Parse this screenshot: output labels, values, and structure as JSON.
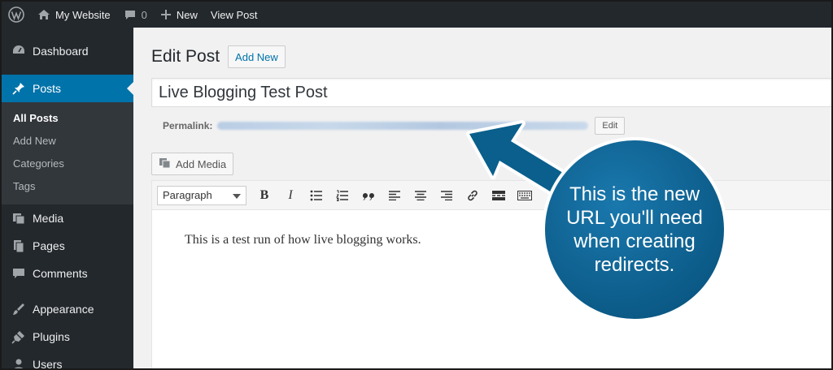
{
  "admin_bar": {
    "site_name": "My Website",
    "comments_count": "0",
    "new_label": "New",
    "view_post_label": "View Post"
  },
  "sidebar": {
    "items": [
      {
        "label": "Dashboard",
        "icon": "dashboard-icon"
      },
      {
        "label": "Posts",
        "icon": "pin-icon",
        "current": true
      },
      {
        "label": "Media",
        "icon": "media-icon"
      },
      {
        "label": "Pages",
        "icon": "pages-icon"
      },
      {
        "label": "Comments",
        "icon": "comments-icon"
      },
      {
        "label": "Appearance",
        "icon": "brush-icon"
      },
      {
        "label": "Plugins",
        "icon": "plugin-icon"
      },
      {
        "label": "Users",
        "icon": "users-icon"
      }
    ],
    "posts_submenu": [
      "All Posts",
      "Add New",
      "Categories",
      "Tags"
    ]
  },
  "main": {
    "page_title": "Edit Post",
    "add_new_label": "Add New",
    "post_title": "Live Blogging Test Post",
    "permalink_label": "Permalink:",
    "edit_label": "Edit",
    "add_media_label": "Add Media",
    "format_select_value": "Paragraph",
    "body_text": "This is a test run of how live blogging works."
  },
  "callout": {
    "text": "This is the new URL you'll need when creating redirects.",
    "color": "#0a5f8c"
  },
  "colors": {
    "admin_bar": "#23282d",
    "accent": "#0073aa",
    "submenu_bg": "#32373c"
  }
}
